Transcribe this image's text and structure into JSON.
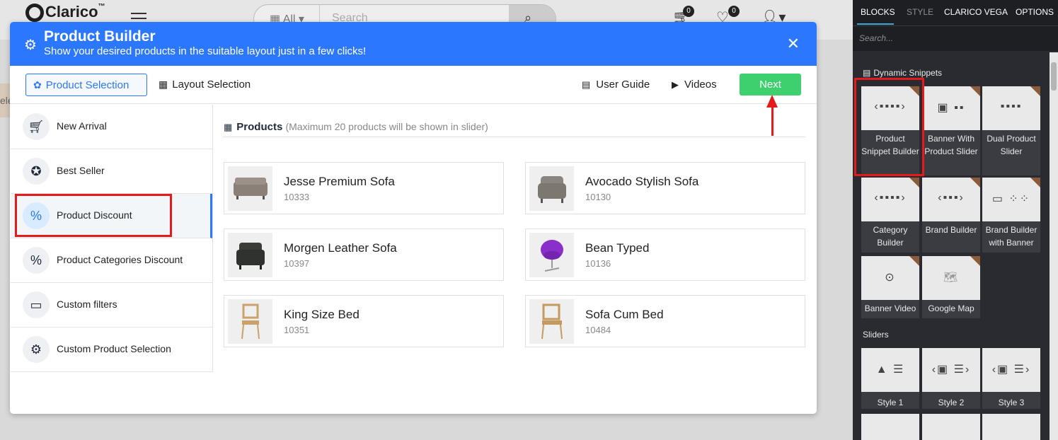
{
  "site": {
    "logo": "Clarico",
    "logo_tm": "™",
    "search_category": "All",
    "search_placeholder": "Search",
    "cart_count": "0",
    "wishlist_count": "0",
    "strip_text": "ele"
  },
  "modal": {
    "title": "Product Builder",
    "subtitle": "Show your desired products in the suitable layout just in a few clicks!",
    "tabs": {
      "product_selection": "Product Selection",
      "layout_selection": "Layout Selection"
    },
    "links": {
      "user_guide": "User Guide",
      "videos": "Videos"
    },
    "next_label": "Next",
    "sidebar": [
      {
        "label": "New Arrival",
        "icon": "cart-icon"
      },
      {
        "label": "Best Seller",
        "icon": "award-icon"
      },
      {
        "label": "Product Discount",
        "icon": "discount-bag-icon"
      },
      {
        "label": "Product Categories Discount",
        "icon": "category-discount-icon"
      },
      {
        "label": "Custom filters",
        "icon": "filter-window-icon"
      },
      {
        "label": "Custom Product Selection",
        "icon": "gear-icon"
      }
    ],
    "products_heading": "Products",
    "products_note": "(Maximum 20 products will be shown in slider)",
    "products": [
      {
        "name": "Jesse Premium Sofa",
        "code": "10333"
      },
      {
        "name": "Avocado Stylish Sofa",
        "code": "10130"
      },
      {
        "name": "Morgen Leather Sofa",
        "code": "10397"
      },
      {
        "name": "Bean Typed",
        "code": "10136"
      },
      {
        "name": "King Size Bed",
        "code": "10351"
      },
      {
        "name": "Sofa Cum Bed",
        "code": "10484"
      }
    ]
  },
  "panel": {
    "tabs": [
      "BLOCKS",
      "STYLE",
      "CLARICO VEGA",
      "OPTIONS"
    ],
    "search_placeholder": "Search...",
    "section_dynamic": "Dynamic Snippets",
    "dynamic_blocks": [
      {
        "label": "Product Snippet Builder"
      },
      {
        "label": "Banner With Product Slider"
      },
      {
        "label": "Dual Product Slider"
      },
      {
        "label": "Category Builder"
      },
      {
        "label": "Brand Builder"
      },
      {
        "label": "Brand Builder with Banner"
      },
      {
        "label": "Banner Video"
      },
      {
        "label": "Google Map"
      }
    ],
    "section_sliders": "Sliders",
    "slider_blocks": [
      {
        "label": "Style 1"
      },
      {
        "label": "Style 2"
      },
      {
        "label": "Style 3"
      }
    ]
  },
  "colors": {
    "accent_blue": "#2b78ff",
    "next_green": "#3ecf6f",
    "highlight_red": "#e51b1b",
    "panel_dark": "#2a2b30"
  }
}
